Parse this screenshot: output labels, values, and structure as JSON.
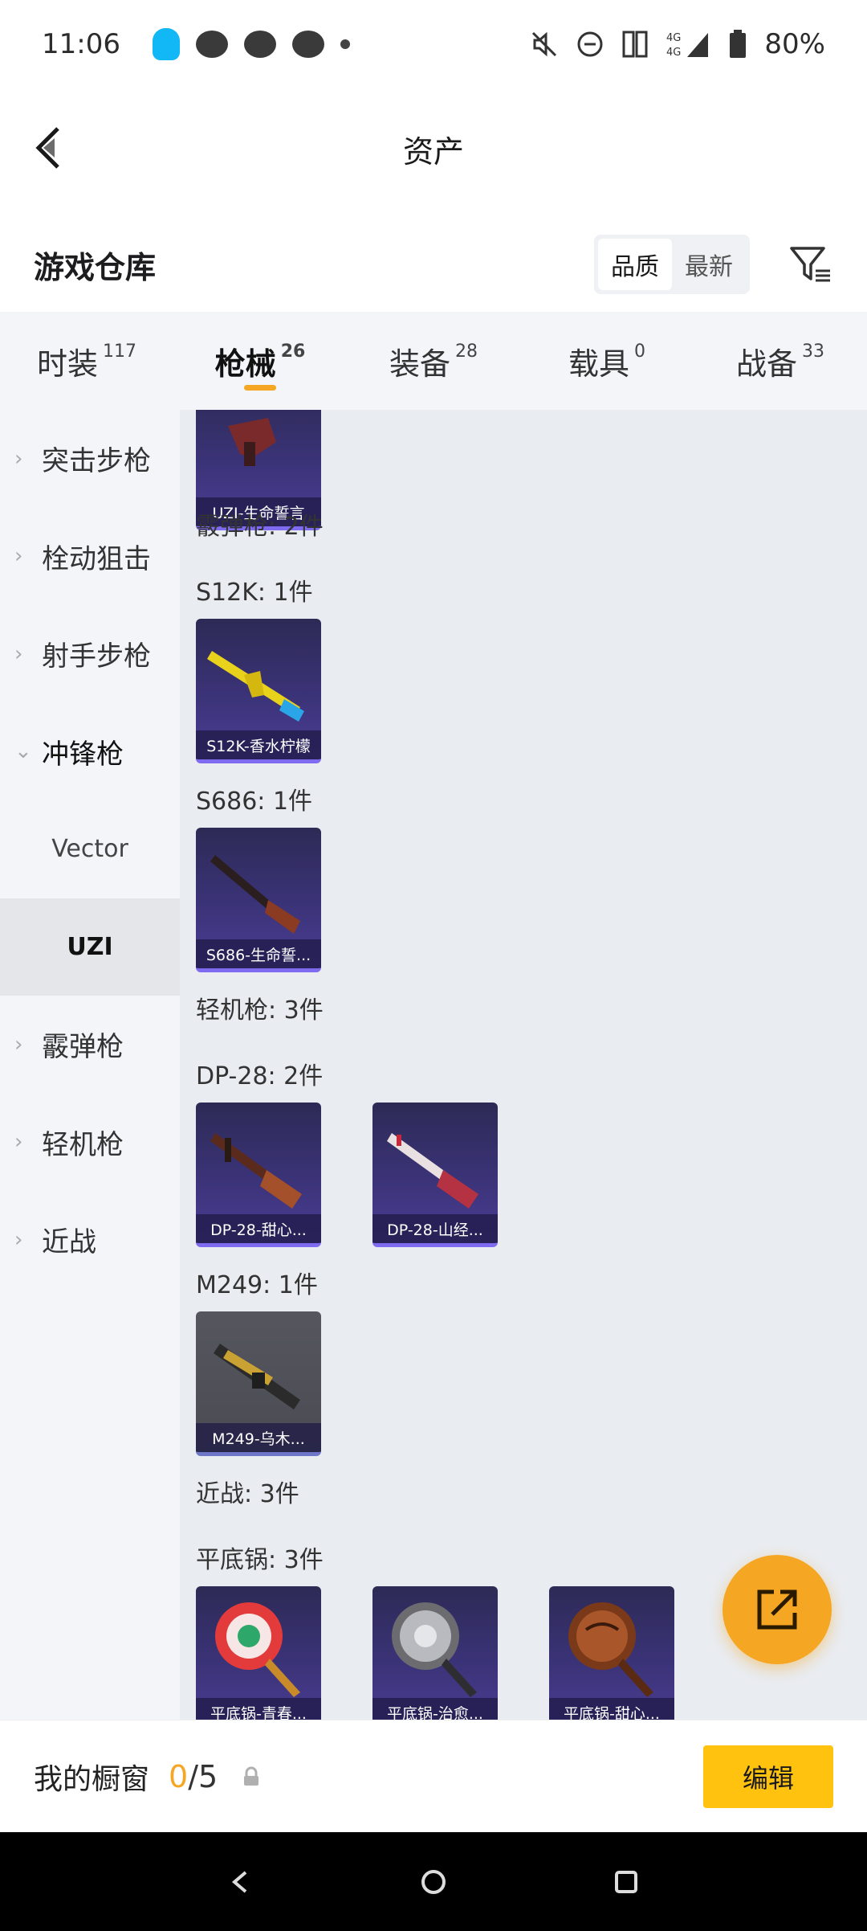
{
  "status_bar": {
    "time": "11:06",
    "battery": "80%"
  },
  "header": {
    "title": "资产"
  },
  "warehouse": {
    "title": "游戏仓库",
    "sort_quality": "品质",
    "sort_newest": "最新"
  },
  "tabs": [
    {
      "label": "时装",
      "count": "117"
    },
    {
      "label": "枪械",
      "count": "26"
    },
    {
      "label": "装备",
      "count": "28"
    },
    {
      "label": "载具",
      "count": "0"
    },
    {
      "label": "战备",
      "count": "33"
    }
  ],
  "sidebar": {
    "items": [
      {
        "label": "突击步枪"
      },
      {
        "label": "栓动狙击"
      },
      {
        "label": "射手步枪"
      },
      {
        "label": "冲锋枪"
      },
      {
        "label": "Vector"
      },
      {
        "label": "UZI"
      },
      {
        "label": "霰弹枪"
      },
      {
        "label": "轻机枪"
      },
      {
        "label": "近战"
      }
    ]
  },
  "content": {
    "groups": [
      {
        "label": "霰弹枪: 2件"
      },
      {
        "label": "S12K: 1件"
      },
      {
        "label": "S686: 1件"
      },
      {
        "label": "轻机枪: 3件"
      },
      {
        "label": "DP-28: 2件"
      },
      {
        "label": "M249: 1件"
      },
      {
        "label": "近战: 3件"
      },
      {
        "label": "平底锅: 3件"
      }
    ],
    "items": [
      {
        "name": "UZI-生命誓言"
      },
      {
        "name": "S12K-香水柠檬"
      },
      {
        "name": "S686-生命誓..."
      },
      {
        "name": "DP-28-甜心..."
      },
      {
        "name": "DP-28-山经..."
      },
      {
        "name": "M249-乌木..."
      },
      {
        "name": "平底锅-青春..."
      },
      {
        "name": "平底锅-治愈..."
      },
      {
        "name": "平底锅-甜心..."
      }
    ]
  },
  "bottom": {
    "label": "我的橱窗",
    "current": "0",
    "total": "/5",
    "edit": "编辑"
  },
  "colors": {
    "accent": "#f5a623",
    "button": "#ffc20e"
  }
}
